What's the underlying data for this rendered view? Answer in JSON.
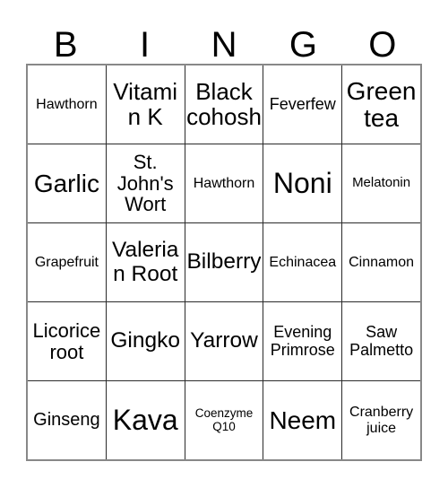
{
  "card": {
    "title_letters": [
      "B",
      "I",
      "N",
      "G",
      "O"
    ],
    "grid_size": "5x5",
    "border_color": "#2b2b2b",
    "outer_border_color": "#888888",
    "background_color": "#ffffff",
    "text_color": "#000000"
  },
  "grid": {
    "rows": [
      {
        "cells": [
          {
            "text": "Hawthorn",
            "size": "fs-16"
          },
          {
            "text": "Vitamin K",
            "size": "fs-26"
          },
          {
            "text": "Black cohosh",
            "size": "fs-26"
          },
          {
            "text": "Feverfew",
            "size": "fs-18"
          },
          {
            "text": "Green tea",
            "size": "fs-28"
          }
        ]
      },
      {
        "cells": [
          {
            "text": "Garlic",
            "size": "fs-28"
          },
          {
            "text": "St. John's Wort",
            "size": "fs-22"
          },
          {
            "text": "Hawthorn",
            "size": "fs-16"
          },
          {
            "text": "Noni",
            "size": "fs-32"
          },
          {
            "text": "Melatonin",
            "size": "fs-15"
          }
        ]
      },
      {
        "cells": [
          {
            "text": "Grapefruit",
            "size": "fs-16"
          },
          {
            "text": "Valerian Root",
            "size": "fs-24"
          },
          {
            "text": "Bilberry",
            "size": "fs-24"
          },
          {
            "text": "Echinacea",
            "size": "fs-16"
          },
          {
            "text": "Cinnamon",
            "size": "fs-16"
          }
        ]
      },
      {
        "cells": [
          {
            "text": "Licorice root",
            "size": "fs-22"
          },
          {
            "text": "Gingko",
            "size": "fs-24"
          },
          {
            "text": "Yarrow",
            "size": "fs-24"
          },
          {
            "text": "Evening Primrose",
            "size": "fs-18"
          },
          {
            "text": "Saw Palmetto",
            "size": "fs-18"
          }
        ]
      },
      {
        "cells": [
          {
            "text": "Ginseng",
            "size": "fs-20"
          },
          {
            "text": "Kava",
            "size": "fs-32"
          },
          {
            "text": "Coenzyme Q10",
            "size": "fs-10"
          },
          {
            "text": "Neem",
            "size": "fs-28"
          },
          {
            "text": "Cranberry juice",
            "size": "fs-16"
          }
        ]
      }
    ]
  }
}
